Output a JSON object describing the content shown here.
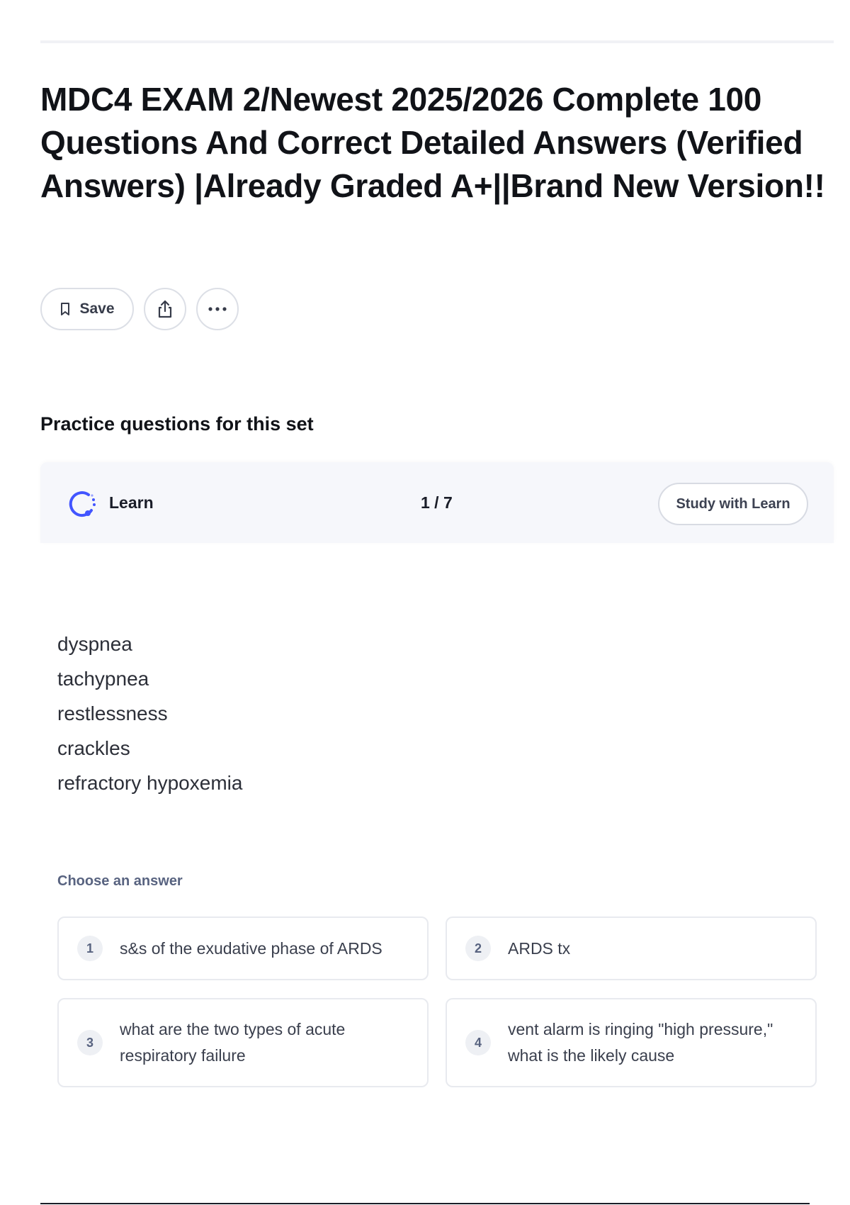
{
  "page": {
    "title": "MDC4 EXAM 2/Newest 2025/2026 Complete 100 Questions And Correct Detailed Answers (Verified Answers) |Already Graded A+||Brand New Version!!"
  },
  "actions": {
    "save_label": "Save",
    "save_icon": "bookmark-icon",
    "share_icon": "share-icon",
    "more_icon": "more-options-icon"
  },
  "practice": {
    "heading": "Practice questions for this set",
    "mode_label": "Learn",
    "counter": "1 / 7",
    "study_button": "Study with Learn",
    "term_lines": [
      "dyspnea",
      "tachypnea",
      "restlessness",
      "crackles",
      "refractory hypoxemia"
    ],
    "choose_label": "Choose an answer",
    "answers": [
      {
        "number": "1",
        "text": "s&s of the exudative phase of ARDS"
      },
      {
        "number": "2",
        "text": "ARDS tx"
      },
      {
        "number": "3",
        "text": "what are the two types of acute respiratory failure"
      },
      {
        "number": "4",
        "text": "vent alarm is ringing \"high pressure,\" what is the likely cause"
      }
    ]
  },
  "colors": {
    "accent": "#4255ff",
    "header_bg": "#f6f7fb",
    "muted_text": "#586380",
    "border": "#e8eaef"
  }
}
